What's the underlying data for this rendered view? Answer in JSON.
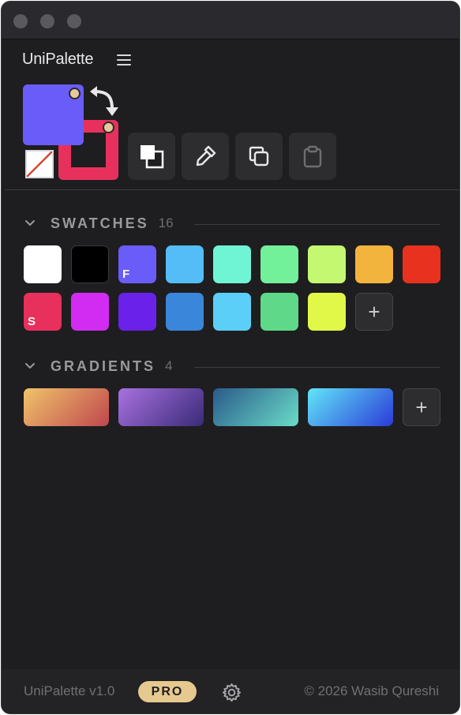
{
  "app": {
    "title": "UniPalette"
  },
  "colors": {
    "fill": "#6a5cf8",
    "stroke": "#e8305c",
    "accent_pro": "#e6c98f"
  },
  "toolbar": {
    "buttons": [
      {
        "name": "fill-stroke-default-icon"
      },
      {
        "name": "eyedropper-icon"
      },
      {
        "name": "copy-icon"
      },
      {
        "name": "paste-icon",
        "disabled": true
      }
    ]
  },
  "swatches": {
    "label": "SWATCHES",
    "count": "16",
    "items": [
      {
        "color": "#ffffff",
        "tag": ""
      },
      {
        "color": "#000000",
        "tag": ""
      },
      {
        "color": "#6a5cf8",
        "tag": "F"
      },
      {
        "color": "#54bdf8",
        "tag": ""
      },
      {
        "color": "#70f5d4",
        "tag": ""
      },
      {
        "color": "#72f09a",
        "tag": ""
      },
      {
        "color": "#c4f870",
        "tag": ""
      },
      {
        "color": "#f3b43e",
        "tag": ""
      },
      {
        "color": "#e8321f",
        "tag": ""
      },
      {
        "color": "#e8305c",
        "tag": "S"
      },
      {
        "color": "#d22cf2",
        "tag": ""
      },
      {
        "color": "#6a22ea",
        "tag": ""
      },
      {
        "color": "#3a86db",
        "tag": ""
      },
      {
        "color": "#5ccff8",
        "tag": ""
      },
      {
        "color": "#60d88a",
        "tag": ""
      },
      {
        "color": "#e2f848",
        "tag": ""
      }
    ],
    "add_label": "+"
  },
  "gradients": {
    "label": "GRADIENTS",
    "count": "4",
    "items": [
      {
        "from": "#f0c46a",
        "to": "#c0464e"
      },
      {
        "from": "#a872e0",
        "to": "#3a2a78"
      },
      {
        "from": "#2a5a8a",
        "to": "#6adcc8"
      },
      {
        "from": "#62e6f8",
        "to": "#2a3ad8"
      }
    ],
    "add_label": "+"
  },
  "footer": {
    "version": "UniPalette v1.0",
    "badge": "PRO",
    "copyright": "© 2026 Wasib Qureshi"
  }
}
